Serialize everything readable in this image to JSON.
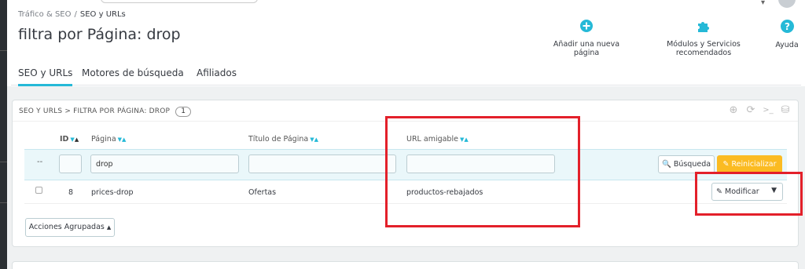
{
  "breadcrumb": {
    "parent": "Tráfico & SEO",
    "separator": "/",
    "current": "SEO y URLs"
  },
  "page_title": "filtra por Página: drop",
  "toolbar": {
    "add_label": "Añadir una nueva página",
    "modules_label": "Módulos y Servicios recomendados",
    "help_label": "Ayuda",
    "accent": "#25b9d7"
  },
  "tabs": [
    {
      "label": "SEO y URLs",
      "active": true
    },
    {
      "label": "Motores de búsqueda",
      "active": false
    },
    {
      "label": "Afiliados",
      "active": false
    }
  ],
  "panel": {
    "title": "SEO Y URLS > FILTRA POR PÁGINA: DROP",
    "count": "1"
  },
  "table": {
    "headers": {
      "id": "ID",
      "page": "Página",
      "title": "Título de Página",
      "url": "URL amigable"
    },
    "filter": {
      "dots": "--",
      "id": "",
      "page": "drop",
      "title": "",
      "url": ""
    },
    "search_label": "Búsqueda",
    "reset_label": "Reinicializar",
    "rows": [
      {
        "id": "8",
        "page": "prices-drop",
        "title": "Ofertas",
        "url": "productos-rebajados",
        "action": "Modificar"
      }
    ]
  },
  "bulk_label": "Acciones Agrupadas",
  "highlight_color": "#e3202a"
}
